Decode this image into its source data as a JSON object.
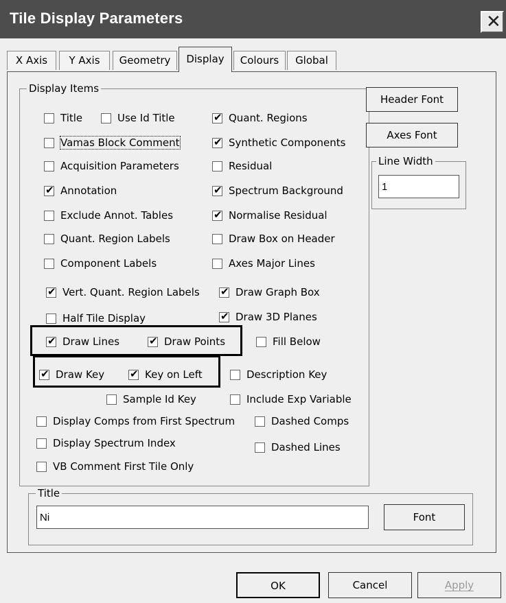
{
  "window": {
    "title": "Tile Display Parameters",
    "close_glyph": "✕"
  },
  "tabs": [
    {
      "label": "X Axis"
    },
    {
      "label": "Y Axis"
    },
    {
      "label": "Geometry"
    },
    {
      "label": "Display",
      "active": true
    },
    {
      "label": "Colours"
    },
    {
      "label": "Global"
    }
  ],
  "display_items": {
    "label": "Display Items",
    "checkboxes": [
      {
        "label": "Title",
        "checked": false
      },
      {
        "label": "Use Id Title",
        "checked": false
      },
      {
        "label": "Quant. Regions",
        "checked": true
      },
      {
        "label": "Vamas Block Comment",
        "checked": false
      },
      {
        "label": "Synthetic Components",
        "checked": true
      },
      {
        "label": "Acquisition Parameters",
        "checked": false
      },
      {
        "label": "Residual",
        "checked": false
      },
      {
        "label": "Annotation",
        "checked": true
      },
      {
        "label": "Spectrum Background",
        "checked": true
      },
      {
        "label": "Exclude Annot. Tables",
        "checked": false
      },
      {
        "label": "Normalise Residual",
        "checked": true
      },
      {
        "label": "Quant. Region Labels",
        "checked": false
      },
      {
        "label": "Draw Box on Header",
        "checked": false
      },
      {
        "label": "Component Labels",
        "checked": false
      },
      {
        "label": "Axes Major Lines",
        "checked": false
      },
      {
        "label": "Vert. Quant. Region Labels",
        "checked": true
      },
      {
        "label": "Draw Graph Box",
        "checked": true
      },
      {
        "label": "Half Tile Display",
        "checked": false
      },
      {
        "label": "Draw 3D Planes",
        "checked": true
      },
      {
        "label": "Draw Lines",
        "checked": true
      },
      {
        "label": "Draw Points",
        "checked": true
      },
      {
        "label": "Fill Below",
        "checked": false
      },
      {
        "label": "Draw Key",
        "checked": true
      },
      {
        "label": "Key on Left",
        "checked": true
      },
      {
        "label": "Description Key",
        "checked": false
      },
      {
        "label": "Sample Id Key",
        "checked": false
      },
      {
        "label": "Include Exp Variable",
        "checked": false
      },
      {
        "label": "Display Comps from First Spectrum",
        "checked": false
      },
      {
        "label": "Dashed Comps",
        "checked": false
      },
      {
        "label": "Display Spectrum Index",
        "checked": false
      },
      {
        "label": "Dashed Lines",
        "checked": false
      },
      {
        "label": "VB Comment First Tile Only",
        "checked": false
      }
    ]
  },
  "side": {
    "header_font_label": "Header Font",
    "axes_font_label": "Axes Font",
    "line_width_label": "Line Width",
    "line_width_value": "1"
  },
  "title_group": {
    "label": "Title",
    "value": "Ni",
    "font_label": "Font"
  },
  "footer": {
    "ok_label": "OK",
    "cancel_label": "Cancel",
    "apply_label": "Apply"
  },
  "colors": {
    "titlebar": "#4d4d4d",
    "dialog_bg": "#efefef",
    "disabled_text": "#9a9a9a"
  }
}
